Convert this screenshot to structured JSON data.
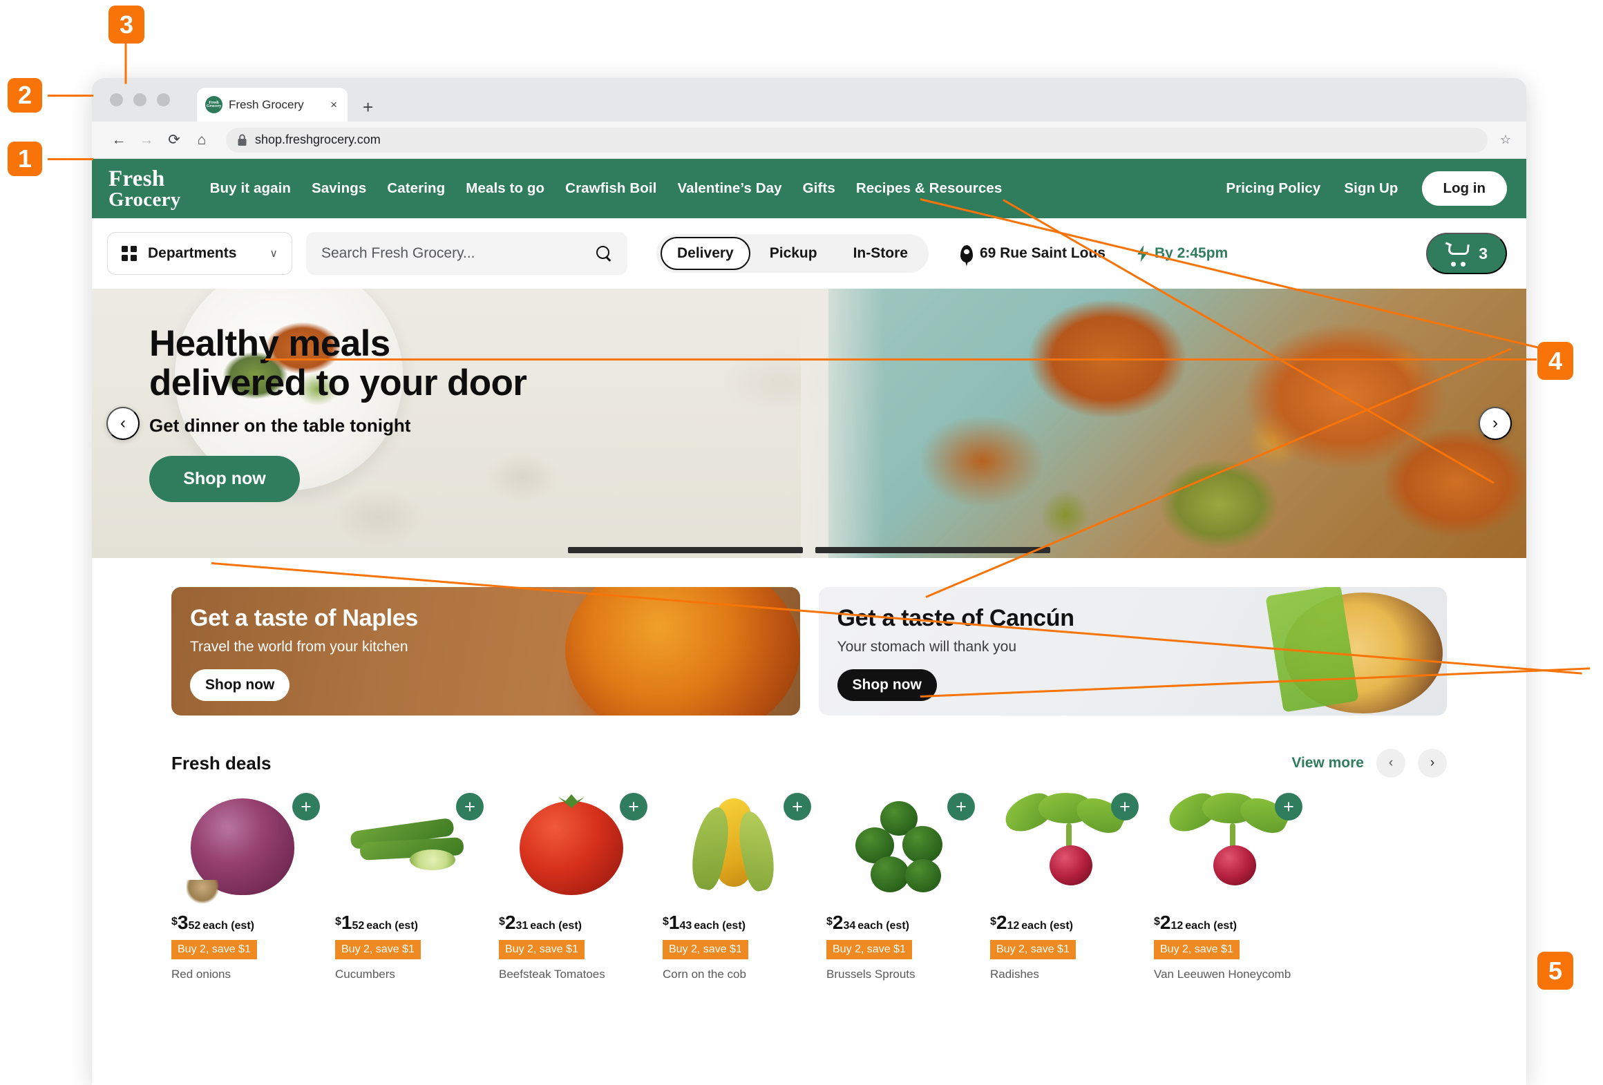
{
  "browser": {
    "tab_title": "Fresh Grocery",
    "tab_favicon_text": "Fresh Grocery",
    "tab_close": "×",
    "new_tab": "+",
    "back_icon": "←",
    "forward_icon": "→",
    "reload_icon": "⟳",
    "home_icon": "⌂",
    "lock_icon": "🔒",
    "url": "shop.freshgrocery.com",
    "bookmark_icon": "☆"
  },
  "header": {
    "logo_line1": "Fresh",
    "logo_line2": "Grocery",
    "nav": [
      {
        "label": "Buy it again"
      },
      {
        "label": "Savings"
      },
      {
        "label": "Catering"
      },
      {
        "label": "Meals to go"
      },
      {
        "label": "Crawfish Boil"
      },
      {
        "label": "Valentine’s Day"
      },
      {
        "label": "Gifts"
      },
      {
        "label": "Recipes & Resources"
      }
    ],
    "pricing_policy": "Pricing Policy",
    "sign_up": "Sign Up",
    "log_in": "Log in"
  },
  "utility": {
    "departments_label": "Departments",
    "departments_chevron": "∨",
    "search_placeholder": "Search Fresh Grocery...",
    "modes": [
      {
        "label": "Delivery",
        "active": true
      },
      {
        "label": "Pickup",
        "active": false
      },
      {
        "label": "In-Store",
        "active": false
      }
    ],
    "address": "69 Rue Saint Lous",
    "eta": "By 2:45pm",
    "cart_count": "3"
  },
  "hero": {
    "headline_line1": "Healthy meals",
    "headline_line2": "delivered to your door",
    "subhead": "Get dinner on the table tonight",
    "cta": "Shop now",
    "prev_icon": "‹",
    "next_icon": "›"
  },
  "promos": [
    {
      "id": "naples",
      "title": "Get a taste of Naples",
      "subtitle": "Travel the world from your kitchen",
      "cta": "Shop now"
    },
    {
      "id": "cancun",
      "title": "Get a taste of Cancún",
      "subtitle": "Your stomach will thank you",
      "cta": "Shop now"
    }
  ],
  "deals": {
    "title": "Fresh deals",
    "view_more": "View more",
    "prev_icon": "‹",
    "next_icon": "›",
    "add_icon": "+",
    "products": [
      {
        "name": "Red onions",
        "currency": "$",
        "dollars": "3",
        "cents": "52",
        "unit": "each (est)",
        "badge": "Buy 2, save $1"
      },
      {
        "name": "Cucumbers",
        "currency": "$",
        "dollars": "1",
        "cents": "52",
        "unit": "each (est)",
        "badge": "Buy 2, save $1"
      },
      {
        "name": "Beefsteak Tomatoes",
        "currency": "$",
        "dollars": "2",
        "cents": "31",
        "unit": "each (est)",
        "badge": "Buy 2, save $1"
      },
      {
        "name": "Corn on the cob",
        "currency": "$",
        "dollars": "1",
        "cents": "43",
        "unit": "each (est)",
        "badge": "Buy 2, save $1"
      },
      {
        "name": "Brussels Sprouts",
        "currency": "$",
        "dollars": "2",
        "cents": "34",
        "unit": "each (est)",
        "badge": "Buy 2, save $1"
      },
      {
        "name": "Radishes",
        "currency": "$",
        "dollars": "2",
        "cents": "12",
        "unit": "each (est)",
        "badge": "Buy 2, save $1"
      },
      {
        "name": "Van Leeuwen Honeycomb",
        "currency": "$",
        "dollars": "2",
        "cents": "12",
        "unit": "each (est)",
        "badge": "Buy 2, save $1"
      }
    ]
  },
  "annotations": [
    {
      "id": "1",
      "label": "1"
    },
    {
      "id": "2",
      "label": "2"
    },
    {
      "id": "3",
      "label": "3"
    },
    {
      "id": "4",
      "label": "4"
    },
    {
      "id": "5",
      "label": "5"
    }
  ],
  "colors": {
    "brand_green": "#2f7d5d",
    "annotation_orange": "#f97408",
    "badge_orange": "#ef8a22"
  }
}
